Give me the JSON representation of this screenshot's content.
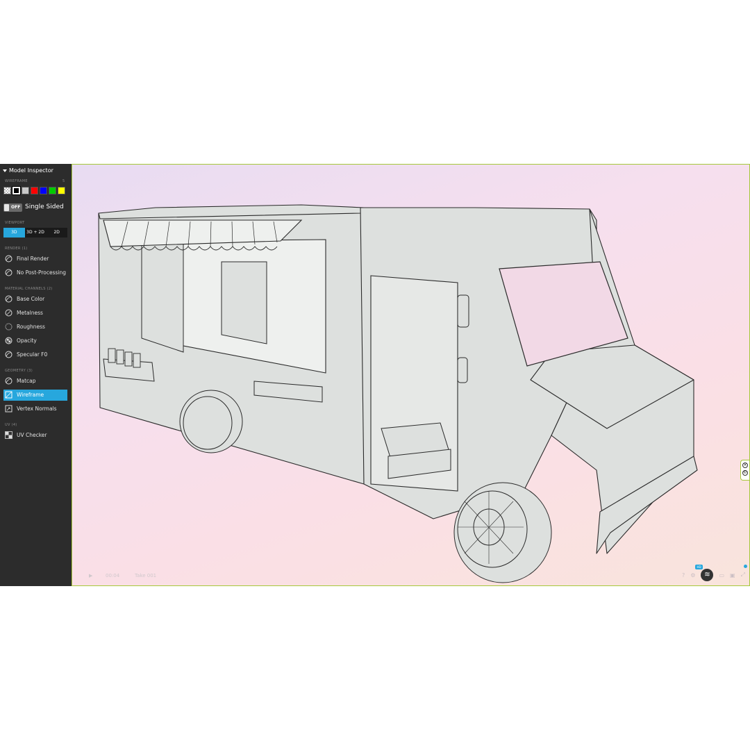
{
  "panel": {
    "title": "Model Inspector",
    "wireframe_section": "WIREFRAME",
    "wireframe_count": "5",
    "wireframe_colors": [
      "#ffffff",
      "#000000",
      "#c8c8c8",
      "#ff0000",
      "#0000ff",
      "#00cc00",
      "#ffff00"
    ],
    "single_sided": {
      "state": "OFF",
      "label": "Single Sided"
    },
    "viewport_section": "VIEWPORT",
    "viewport_options": [
      "3D",
      "3D + 2D",
      "2D"
    ],
    "viewport_selected": "3D",
    "render_section": "RENDER (1)",
    "render_items": [
      "Final Render",
      "No Post-Processing"
    ],
    "material_section": "MATERIAL CHANNELS (2)",
    "material_items": [
      "Base Color",
      "Metalness",
      "Roughness",
      "Opacity",
      "Specular F0"
    ],
    "geometry_section": "GEOMETRY (3)",
    "geometry_items": [
      "Matcap",
      "Wireframe",
      "Vertex Normals"
    ],
    "geometry_selected": "Wireframe",
    "uv_section": "UV (4)",
    "uv_items": [
      "UV Checker"
    ]
  },
  "viewer": {
    "time": "00:04",
    "take": "Take 001",
    "hd_badge": "HD",
    "accent_color": "#27a7dd",
    "frame_color": "#a6c83a"
  }
}
